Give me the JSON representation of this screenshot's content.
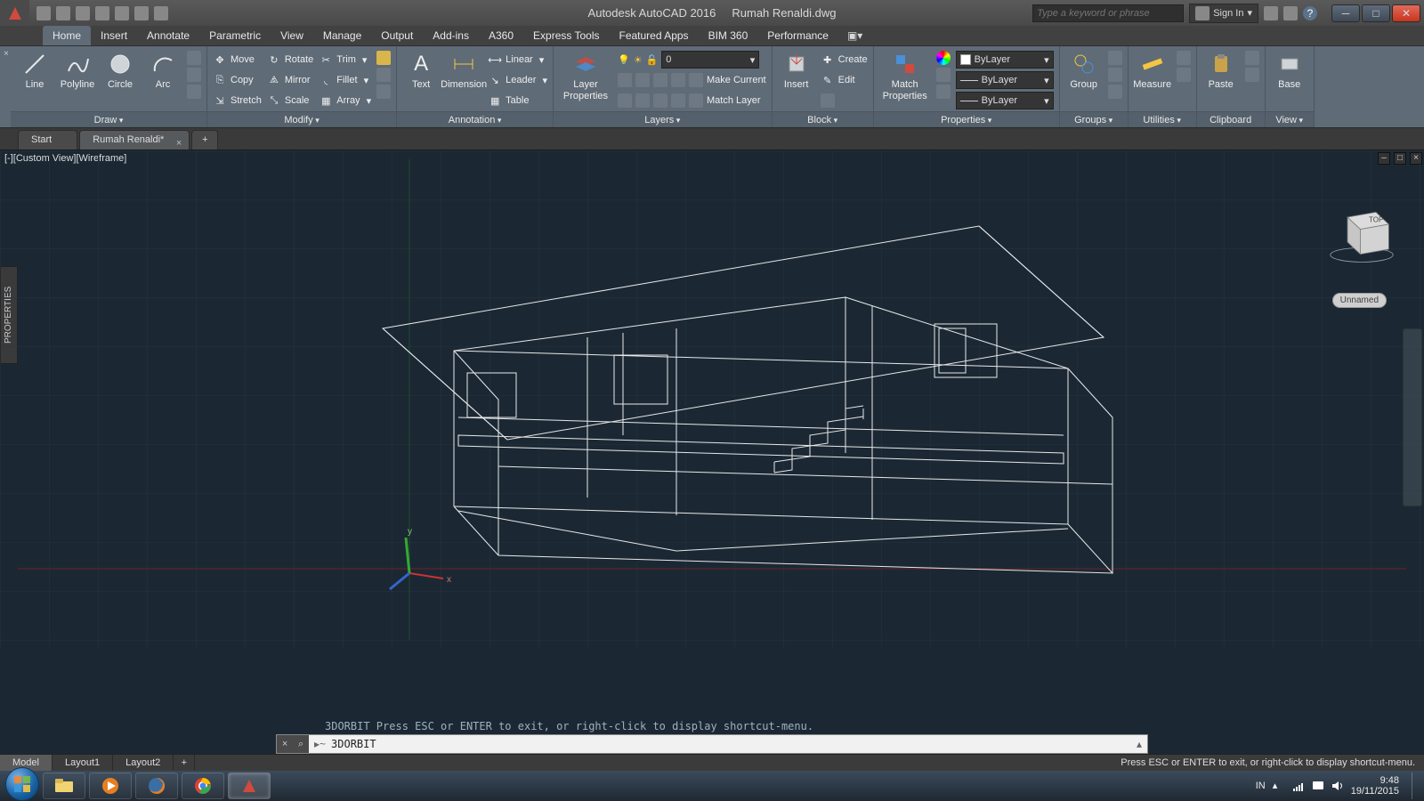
{
  "app": {
    "title": "Autodesk AutoCAD 2016",
    "document": "Rumah Renaldi.dwg",
    "search_placeholder": "Type a keyword or phrase",
    "signin": "Sign In"
  },
  "menu": {
    "tabs": [
      "Home",
      "Insert",
      "Annotate",
      "Parametric",
      "View",
      "Manage",
      "Output",
      "Add-ins",
      "A360",
      "Express Tools",
      "Featured Apps",
      "BIM 360",
      "Performance"
    ],
    "active": "Home"
  },
  "ribbon": {
    "draw": {
      "title": "Draw",
      "items": [
        "Line",
        "Polyline",
        "Circle",
        "Arc"
      ]
    },
    "modify": {
      "title": "Modify",
      "col1": [
        "Move",
        "Copy",
        "Stretch"
      ],
      "col2": [
        "Rotate",
        "Mirror",
        "Scale"
      ],
      "col3": [
        "Trim",
        "Fillet",
        "Array"
      ]
    },
    "annotation": {
      "title": "Annotation",
      "big": [
        "Text",
        "Dimension"
      ],
      "stack": [
        "Linear",
        "Leader",
        "Table"
      ]
    },
    "layers": {
      "title": "Layers",
      "big": "Layer Properties",
      "value": "0",
      "stack": [
        "Make Current",
        "Match Layer"
      ]
    },
    "block": {
      "title": "Block",
      "big": "Insert",
      "stack": [
        "Create",
        "Edit"
      ]
    },
    "properties": {
      "title": "Properties",
      "big": "Match Properties",
      "rows": [
        "ByLayer",
        "ByLayer",
        "ByLayer"
      ]
    },
    "groups": {
      "title": "Groups",
      "big": "Group"
    },
    "utilities": {
      "title": "Utilities",
      "big": "Measure"
    },
    "clipboard": {
      "title": "Clipboard",
      "big": "Paste"
    },
    "view": {
      "title": "View",
      "big": "Base"
    }
  },
  "file_tabs": {
    "tabs": [
      {
        "label": "Start",
        "active": false
      },
      {
        "label": "Rumah Renaldi*",
        "active": true
      }
    ]
  },
  "viewport": {
    "label": "[-][Custom View][Wireframe]",
    "viewcube_top": "TOP",
    "unnamed": "Unnamed"
  },
  "command": {
    "history": "3DORBIT Press ESC or ENTER to exit, or right-click to display shortcut-menu.",
    "prompt": "▸~",
    "value": "3DORBIT"
  },
  "layout_tabs": {
    "tabs": [
      "Model",
      "Layout1",
      "Layout2"
    ],
    "active": "Model",
    "status": "Press ESC or ENTER to exit, or right-click to display shortcut-menu."
  },
  "taskbar": {
    "lang": "IN",
    "time": "9:48",
    "date": "19/11/2015"
  },
  "side_panel": "PROPERTIES"
}
